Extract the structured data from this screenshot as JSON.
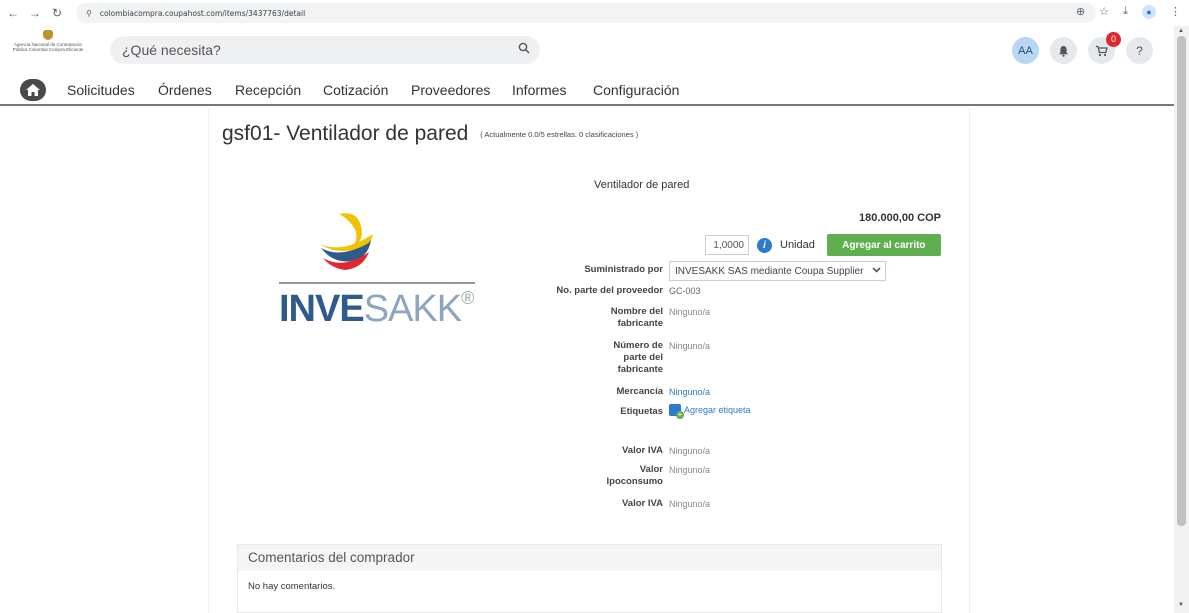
{
  "browser": {
    "url": "colombiacompra.coupahost.com/items/3437763/detail"
  },
  "header": {
    "agency_text": "Agencia Nacional de Contratación Pública Colombia Compra Eficiente",
    "search_placeholder": "¿Qué necesita?",
    "avatar": "AA",
    "cart_count": "0",
    "help": "?"
  },
  "nav": {
    "items": [
      "Solicitudes",
      "Órdenes",
      "Recepción",
      "Cotización",
      "Proveedores",
      "Informes",
      "Configuración"
    ]
  },
  "item": {
    "title": "gsf01- Ventilador de pared",
    "rating_note": "( Actualmente 0.0/5 estrellas. 0 clasificaciones )",
    "description": "Ventilador de pared",
    "price": "180.000,00 COP",
    "quantity": "1,0000",
    "unit": "Unidad",
    "add_to_cart": "Agregar al carrito",
    "brand_logo_text": "INVESAKK®"
  },
  "attributes": {
    "supplied_by_label": "Suministrado por",
    "supplied_by_value": "INVESAKK SAS mediante Coupa Supplier",
    "supplier_part_label": "No. parte del proveedor",
    "supplier_part_value": "GC-003",
    "manufacturer_label": "Nombre del fabricante",
    "manufacturer_value": "Ninguno/a",
    "manufacturer_part_label": "Número de parte del fabricante",
    "manufacturer_part_value": "Ninguno/a",
    "commodity_label": "Mercancía",
    "commodity_value": "Ninguno/a",
    "tags_label": "Etiquetas",
    "add_tag": "Agregar etiqueta",
    "iva_label": "Valor IVA",
    "iva_value": "Ninguno/a",
    "ipoconsumo_label": "Valor Ipoconsumo",
    "ipoconsumo_value": "Ninguno/a",
    "iva2_label": "Valor IVA",
    "iva2_value": "Ninguno/a"
  },
  "comments": {
    "header": "Comentarios del comprador",
    "body": "No hay comentarios."
  },
  "colors": {
    "primary_button": "#5fae4f",
    "link": "#2b7bd0",
    "badge": "#e0282e"
  }
}
